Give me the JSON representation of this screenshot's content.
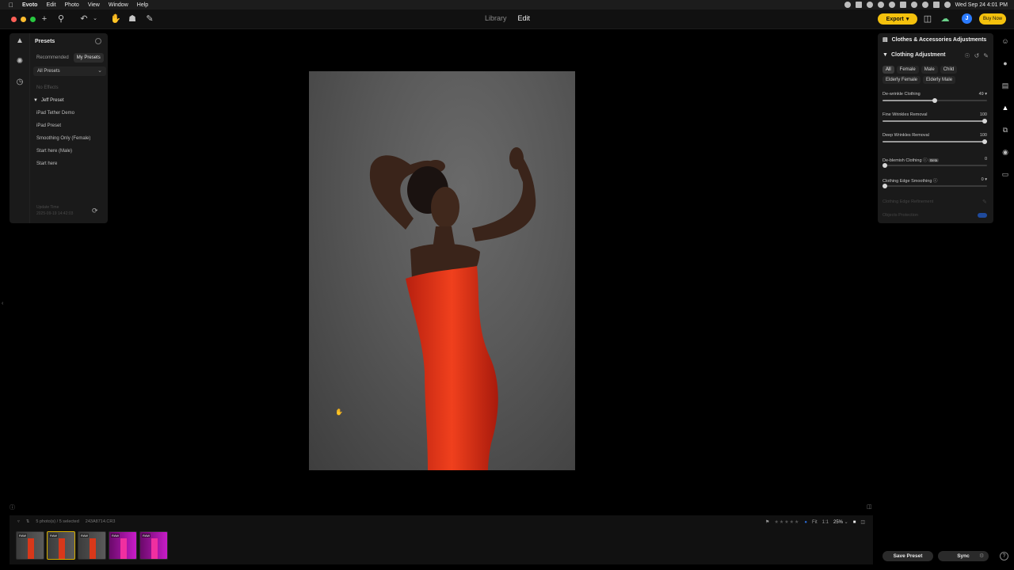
{
  "menubar": {
    "app": "Evoto",
    "items": [
      "Edit",
      "Photo",
      "View",
      "Window",
      "Help"
    ],
    "datetime": "Wed Sep 24  4:01 PM"
  },
  "toolbar": {
    "tabs": [
      "Library",
      "Edit"
    ],
    "active_tab": "Edit",
    "export_label": "Export",
    "buy_label": "Buy Now",
    "avatar_letter": "J"
  },
  "presets": {
    "title": "Presets",
    "tabs": [
      "Recommended",
      "My Presets"
    ],
    "select_value": "All Presets",
    "no_effects": "No Effects",
    "group": "Jeff Preset",
    "items": [
      "iPad Tether Demo",
      "iPad Preset",
      "Smoothing Only (Female)",
      "Start here (Male)",
      "Start here"
    ],
    "update_label": "Update Time",
    "update_time": "2025-09-19 14:42:03"
  },
  "right_panel": {
    "title": "Clothes & Accessories Adjustments",
    "section": "Clothing Adjustment",
    "chips": [
      "All",
      "Female",
      "Male",
      "Child",
      "Elderly Female",
      "Elderly Male"
    ],
    "sliders": [
      {
        "label": "De-wrinkle Clothing",
        "value": 49
      },
      {
        "label": "Fine Wrinkles Removal",
        "value": 100
      },
      {
        "label": "Deep Wrinkles Removal",
        "value": 100
      },
      {
        "label": "De-blemish Clothing",
        "value": 0,
        "badge": "Beta"
      },
      {
        "label": "Clothing Edge Smoothing",
        "value": 0
      }
    ],
    "disabled": [
      "Clothing Edge Refinement",
      "Objects Protection"
    ]
  },
  "filmstrip": {
    "count_text": "5 photo(s) / 5 selected",
    "filename": "243A8714.CR3",
    "fit_label": "Fit",
    "one_to_one": "1:1",
    "zoom": "25%",
    "thumb_tag": "RAW"
  },
  "actions": {
    "save_preset": "Save Preset",
    "sync": "Sync"
  }
}
